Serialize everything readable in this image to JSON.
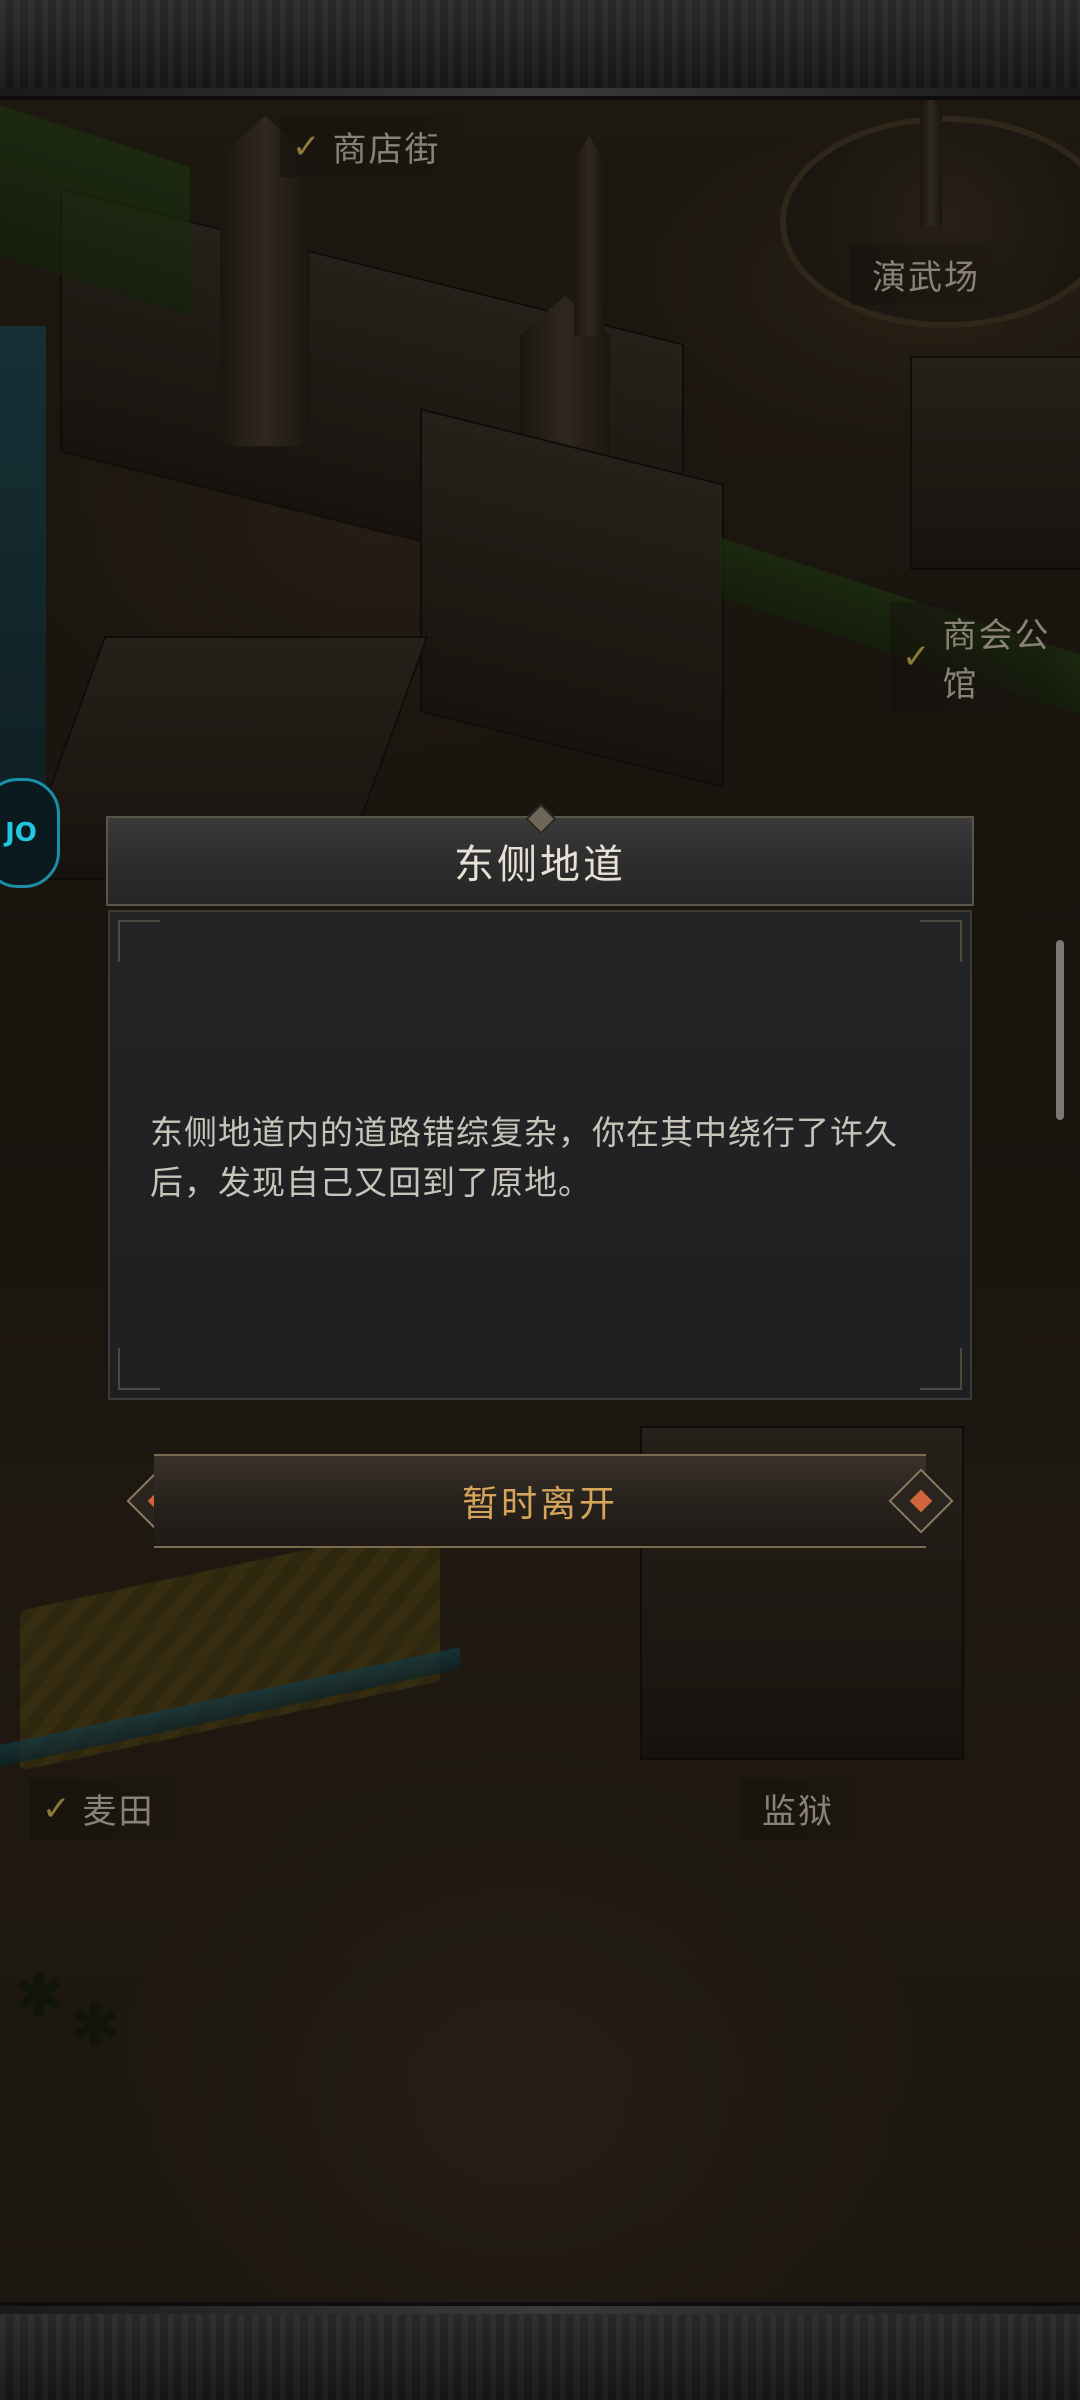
{
  "map": {
    "labels": {
      "shop_street": "商店街",
      "arena": "演武场",
      "merchant_guild": "商会公馆",
      "wheat_field": "麦田",
      "prison": "监狱"
    }
  },
  "side_badge": {
    "text": "JO"
  },
  "dialog": {
    "title": "东侧地道",
    "body": "东侧地道内的道路错综复杂，你在其中绕行了许久后，发现自己又回到了原地。"
  },
  "actions": {
    "leave_label": "暂时离开"
  },
  "colors": {
    "accent_gold": "#d4a55a",
    "accent_orange": "#d0643a",
    "badge_cyan": "#24c7e0"
  }
}
